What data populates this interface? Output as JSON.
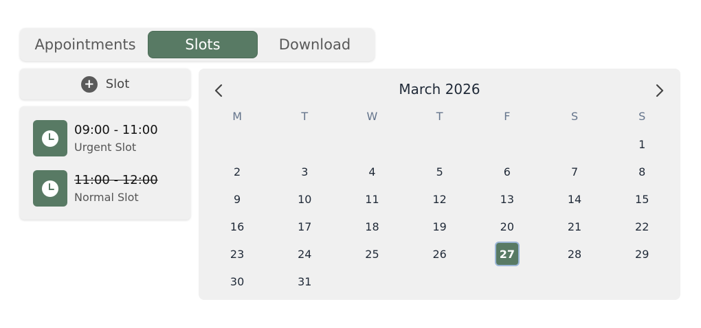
{
  "tabs": [
    {
      "label": "Appointments",
      "active": false
    },
    {
      "label": "Slots",
      "active": true
    },
    {
      "label": "Download",
      "active": false
    }
  ],
  "add_slot": {
    "label": "Slot",
    "icon": "plus-circle-icon"
  },
  "slots": [
    {
      "time": "09:00 - 11:00",
      "type": "Urgent Slot",
      "struck": false,
      "icon": "clock-icon"
    },
    {
      "time": "11:00 - 12:00",
      "type": "Normal Slot",
      "struck": true,
      "icon": "clock-icon"
    }
  ],
  "calendar": {
    "month_title": "March 2026",
    "prev_icon": "chevron-left-icon",
    "next_icon": "chevron-right-icon",
    "weekdays": [
      "M",
      "T",
      "W",
      "T",
      "F",
      "S",
      "S"
    ],
    "first_weekday_index": 6,
    "days_in_month": 31,
    "selected_day": 27
  },
  "colors": {
    "accent": "#587a64",
    "panel": "#f0f0f0",
    "selected_outline": "#9bb6d6"
  }
}
